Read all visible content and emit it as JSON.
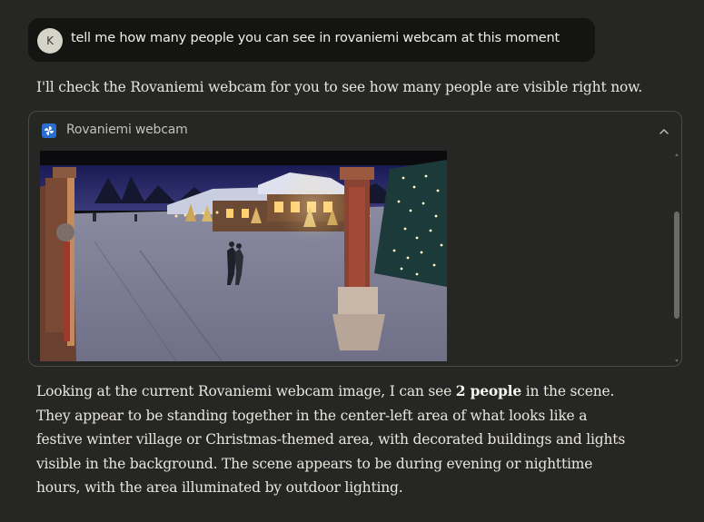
{
  "user_message": {
    "avatar_initial": "K",
    "text": "tell me how many people you can see in rovaniemi webcam at this moment"
  },
  "assistant": {
    "intro": "I'll check the Rovaniemi webcam for you to see how many people are visible right now.",
    "answer_before": "Looking at the current Rovaniemi webcam image, I can see ",
    "answer_bold": "2 people",
    "answer_after": " in the scene. They appear to be standing together in the center-left area of what looks like a festive winter village or Christmas-themed area, with decorated buildings and lights visible in the background. The scene appears to be during evening or nighttime hours, with the area illuminated by outdoor lighting."
  },
  "tool_card": {
    "title": "Rovaniemi webcam",
    "icon": "pinwheel-icon",
    "expanded": true,
    "colors": {
      "icon_bg": "#2a6fd0",
      "card_border": "#4a4945",
      "background": "#262624",
      "user_bubble": "#141413"
    }
  }
}
